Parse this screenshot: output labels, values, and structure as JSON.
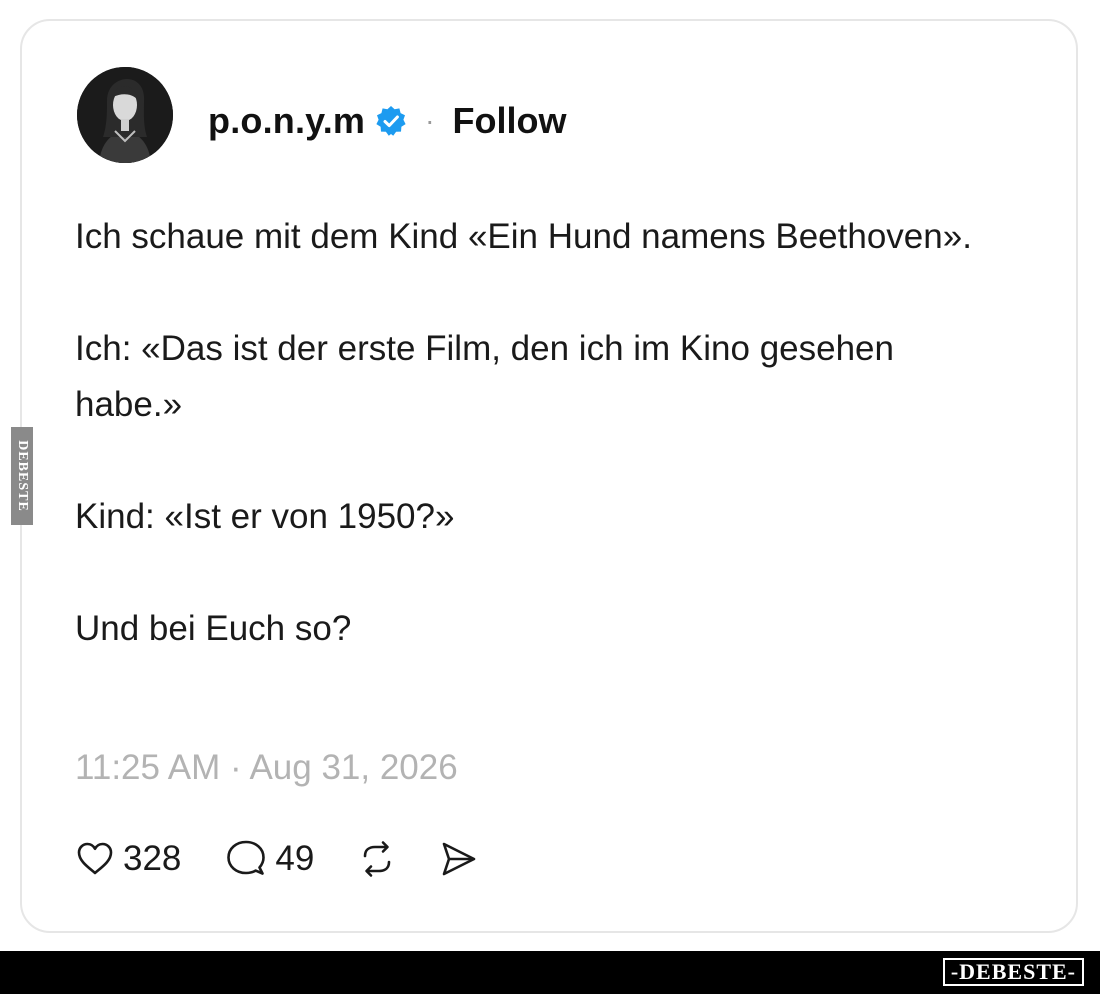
{
  "post": {
    "author": {
      "username": "p.o.n.y.m",
      "verified": true,
      "avatar": "profile-photo"
    },
    "separator": "·",
    "follow_label": "Follow",
    "paragraphs": [
      "Ich schaue mit dem Kind «Ein Hund namens Beethoven».",
      "Ich: «Das ist der erste Film, den ich im Kino gesehen habe.»",
      "Kind: «Ist er von 1950?»",
      "Und bei Euch so?"
    ],
    "timestamp": "11:25 AM · Aug 31, 2026",
    "actions": {
      "like": {
        "icon": "heart-icon",
        "count": "328"
      },
      "reply": {
        "icon": "speech-bubble-icon",
        "count": "49"
      },
      "repost": {
        "icon": "repost-icon"
      },
      "share": {
        "icon": "send-icon"
      }
    }
  },
  "watermark": {
    "side": "DEBESTE",
    "logo": "-DEBESTE-"
  },
  "colors": {
    "verified_badge": "#1d9bf0",
    "border": "#e6e6e6",
    "timestamp": "#b3b3b3"
  }
}
